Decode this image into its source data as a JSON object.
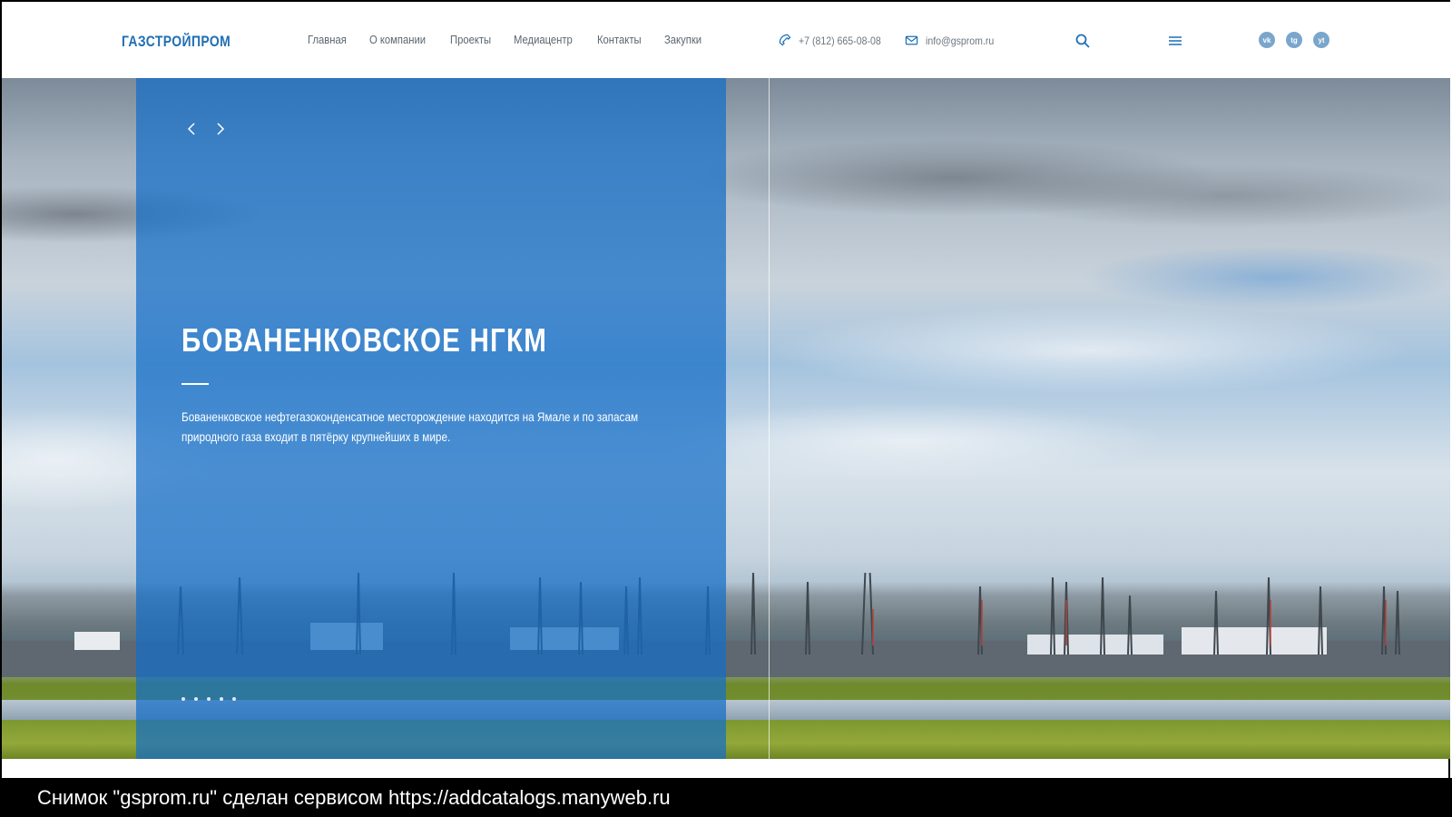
{
  "header": {
    "logo": "ГАЗСТРОЙПРОМ",
    "nav": [
      "Главная",
      "О компании",
      "Проекты",
      "Медиацентр",
      "Контакты",
      "Закупки"
    ],
    "phone": "+7 (812) 665-08-08",
    "email": "info@gsprom.ru",
    "social": [
      "vk",
      "tg",
      "yt"
    ]
  },
  "hero": {
    "title": "БОВАНЕНКОВСКОЕ НГКМ",
    "text": "Бованенковское нефтегазоконденсатное месторождение находится на Ямале и по запасам природного газа входит в пятёрку крупнейших в мире.",
    "slide_count": 5
  },
  "caption": "Снимок \"gsprom.ru\" сделан сервисом https://addcatalogs.manyweb.ru",
  "colors": {
    "brand": "#1f6fb5",
    "overlay": "#146ec8"
  }
}
